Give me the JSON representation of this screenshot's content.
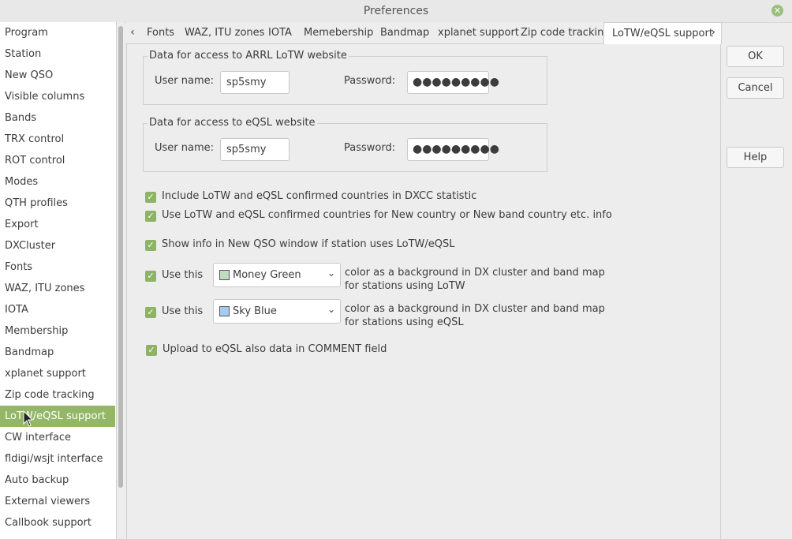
{
  "window": {
    "title": "Preferences",
    "close_glyph": "✕"
  },
  "sidebar": {
    "selected_index": 18,
    "items": [
      {
        "label": "Program"
      },
      {
        "label": "Station"
      },
      {
        "label": "New QSO"
      },
      {
        "label": "Visible columns"
      },
      {
        "label": "Bands"
      },
      {
        "label": "TRX control"
      },
      {
        "label": "ROT control"
      },
      {
        "label": "Modes"
      },
      {
        "label": "QTH profiles"
      },
      {
        "label": "Export"
      },
      {
        "label": "DXCluster"
      },
      {
        "label": "Fonts"
      },
      {
        "label": "WAZ, ITU zones"
      },
      {
        "label": "IOTA"
      },
      {
        "label": "Membership"
      },
      {
        "label": "Bandmap"
      },
      {
        "label": "xplanet support"
      },
      {
        "label": "Zip code tracking"
      },
      {
        "label": "LoTW/eQSL support"
      },
      {
        "label": "CW interface"
      },
      {
        "label": "fldigi/wsjt interface"
      },
      {
        "label": "Auto backup"
      },
      {
        "label": "External viewers"
      },
      {
        "label": "Callbook support"
      }
    ]
  },
  "tabs": {
    "left_arrow": "‹",
    "right_arrow": "›",
    "items": [
      "Fonts",
      "WAZ, ITU zones",
      "IOTA",
      "Memebership",
      "Bandmap",
      "xplanet support",
      "Zip code tracking",
      "LoTW/eQSL support"
    ],
    "active": "LoTW/eQSL support"
  },
  "lotw": {
    "group_title": "Data for access to ARRL LoTW website",
    "user_label": "User name:",
    "user_value": "sp5smy",
    "pass_label": "Password:",
    "pass_value": "●●●●●●●●●"
  },
  "eqsl": {
    "group_title": "Data for access to eQSL website",
    "user_label": "User name:",
    "user_value": "sp5smy",
    "pass_label": "Password:",
    "pass_value": "●●●●●●●●●"
  },
  "options": {
    "include_confirmed": "Include LoTW and eQSL confirmed countries in DXCC statistic",
    "use_confirmed": "Use LoTW and eQSL confirmed countries for New country or New band country etc. info",
    "show_info": "Show info in New QSO window if station uses LoTW/eQSL",
    "use_this": "Use this",
    "lotw_color": {
      "name": "Money Green",
      "hex": "#c0dcc0"
    },
    "lotw_desc_1": "color as a background in DX cluster and band map",
    "lotw_desc_2": "for stations using LoTW",
    "eqsl_color": {
      "name": "Sky Blue",
      "hex": "#a6caf0"
    },
    "eqsl_desc_1": "color as a background in DX cluster and band map",
    "eqsl_desc_2": "for stations using eQSL",
    "upload_comment": "Upload to eQSL also data in COMMENT field",
    "check_glyph": "✓",
    "dropdown_glyph": "⌄"
  },
  "buttons": {
    "ok": "OK",
    "cancel": "Cancel",
    "help": "Help"
  },
  "colors": {
    "accent": "#93b667",
    "checkbox": "#8cb464"
  }
}
